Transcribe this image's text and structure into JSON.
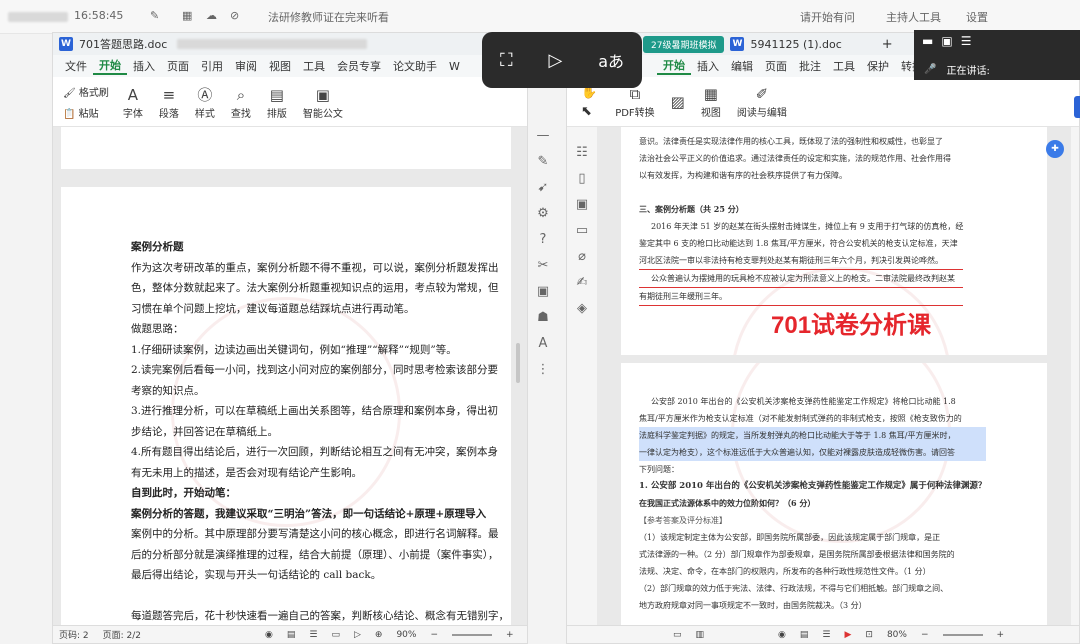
{
  "topbar": {
    "items": [
      "会议待看",
      "16:58:45",
      "法研修教师证在完来听看",
      "请开始有问",
      "主持人工具",
      "设置"
    ]
  },
  "left_window": {
    "tab_title": "701答题思路.doc",
    "menu": [
      "文件",
      "开始",
      "插入",
      "页面",
      "引用",
      "审阅",
      "视图",
      "工具",
      "会员专享",
      "论文助手",
      "W"
    ],
    "ribbon": [
      {
        "icon": "brush-icon",
        "label": "格式刷"
      },
      {
        "icon": "paste-icon",
        "label": "粘贴"
      },
      {
        "icon": "font-icon",
        "label": "字体"
      },
      {
        "icon": "paragraph-icon",
        "label": "段落"
      },
      {
        "icon": "style-icon",
        "label": "样式"
      },
      {
        "icon": "find-icon",
        "label": "查找"
      },
      {
        "icon": "layout-icon",
        "label": "排版"
      },
      {
        "icon": "smartdoc-icon",
        "label": "智能公文"
      }
    ],
    "doc_lines": [
      {
        "t": "案例分析题",
        "b": true
      },
      {
        "t": "作为这次考研改革的重点，案例分析题不得不重视，可以说，案例分析题发挥出",
        "b": false
      },
      {
        "t": "色，整体分数就起来了。法大案例分析题重视知识点的运用，考点较为常规，但",
        "b": false
      },
      {
        "t": "习惯在单个问题上挖坑，建议每道题总结踩坑点进行再动笔。",
        "b": false
      },
      {
        "t": "做题思路：",
        "b": false
      },
      {
        "t": "1.仔细研读案例，边读边画出关键词句，例如“推理”“解释”“规则”等。",
        "b": false
      },
      {
        "t": "2.读完案例后看每一小问，找到这小问对应的案例部分，同时思考检索该部分要",
        "b": false
      },
      {
        "t": "考察的知识点。",
        "b": false
      },
      {
        "t": "3.进行推理分析，可以在草稿纸上画出关系图等，结合原理和案例本身，得出初",
        "b": false
      },
      {
        "t": "步结论，并回答记在草稿纸上。",
        "b": false
      },
      {
        "t": "4.所有题目得出结论后，进行一次回顾，判断结论相互之间有无冲突，案例本身",
        "b": false
      },
      {
        "t": "有无未用上的描述，是否会对现有结论产生影响。",
        "b": false
      },
      {
        "t": "自到此时，开始动笔：",
        "b": true
      },
      {
        "t": "案例分析的答题，我建议采取“三明治”答法，即一句话结论+原理+原理导入",
        "b": true
      },
      {
        "t": "案例中的分析。其中原理部分要写清楚这小问的核心概念，即进行名词解释。最",
        "b": false
      },
      {
        "t": "后的分析部分就是演绎推理的过程，结合大前提（原理）、小前提（案件事实），",
        "b": false
      },
      {
        "t": "最后得出结论，实现与开头一句话结论的 call back。",
        "b": false
      },
      {
        "t": "",
        "b": false
      },
      {
        "t": "每道题答完后，花十秒快速看一遍自己的答案，判断核心结论、概念有无错别字，",
        "b": false
      },
      {
        "t": "基本知识错误，整张试卷答完后，快速查每道题目是不是在对应的位置上，当然，",
        "b": false
      }
    ],
    "status": [
      "页码: 2",
      "页面: 2/2",
      "90%"
    ]
  },
  "right_window": {
    "tabs": [
      "27级暑期班模拟",
      "5941125 (1).doc"
    ],
    "menu": [
      "开始",
      "插入",
      "编辑",
      "页面",
      "批注",
      "工具",
      "保护",
      "转换"
    ],
    "ribbon": [
      {
        "icon": "hand-icon",
        "label": ""
      },
      {
        "icon": "select-icon",
        "label": ""
      },
      {
        "icon": "pdf-convert-icon",
        "label": "PDF转换"
      },
      {
        "icon": "image-icon",
        "label": ""
      },
      {
        "icon": "view-icon",
        "label": "视图"
      },
      {
        "icon": "read-edit-icon",
        "label": "阅读与编辑"
      }
    ],
    "page1": [
      "意识。法律责任是实现法律作用的核心工具，既体现了法的强制性和权威性，也彰显了",
      "法治社会公平正义的价值追求。通过法律责任的设定和实施，法的规范作用、社会作用得",
      "以有效发挥，为构建和谐有序的社会秩序提供了有力保障。",
      "",
      "三、案例分析题（共 25 分）",
      "2016 年天津 51 岁的赵某在街头摆射击摊谋生，摊位上有 9 支用于打气球的仿真枪，经",
      "鉴定其中 6 支的枪口比动能达到 1.8 焦耳/平方厘米，符合公安机关的枪支认定标准，天津",
      "河北区法院一审以非法持有枪支罪判处赵某有期徒刑三年六个月，判决引发舆论哗然。",
      "公众普遍认为摆摊用的玩具枪不应被认定为刑法意义上的枪支。二审法院最终改判赵某",
      "有期徒刑三年缓刑三年。"
    ],
    "overlay_title": "701试卷分析课",
    "page2": [
      "公安部 2010 年出台的《公安机关涉案枪支弹药性能鉴定工作规定》将枪口比动能 1.8",
      "焦耳/平方厘米作为枪支认定标准（对不能发射制式弹药的非制式枪支，按照《枪支致伤力的",
      "法庭科学鉴定判据》的规定，当所发射弹丸的枪口比动能大于等于 1.8 焦耳/平方厘米时，",
      "一律认定为枪支），这个标准远低于大众普遍认知，仅能对裸露皮肤造成轻微伤害。请回答",
      "下列问题：",
      "1. 公安部 2010 年出台的《公安机关涉案枪支弹药性能鉴定工作规定》属于何种法律渊源？",
      "在我国正式法源体系中的效力位阶如何？（6 分）",
      "【参考答案及评分标准】",
      "（1）该规定制定主体为公安部，即国务院所属部委，因此该规定属于部门规章，是正",
      "式法律源的一种。（2 分）部门规章作为部委规章，是国务院所属部委根据法律和国务院的",
      "法规、决定、命令，在本部门的权限内，所发布的各种行政性规范性文件。（1 分）",
      "（2）部门规章的效力低于宪法、法律、行政法规，不得与它们相抵触。部门规章之间、",
      "地方政府规章对同一事项规定不一致时，由国务院裁决。（3 分）"
    ],
    "status": [
      "80%"
    ]
  },
  "float_toolbar": [
    "screenshot-icon",
    "video-ai-icon",
    "translate-icon"
  ],
  "dark_panel": {
    "speaking": "正在讲话:"
  }
}
